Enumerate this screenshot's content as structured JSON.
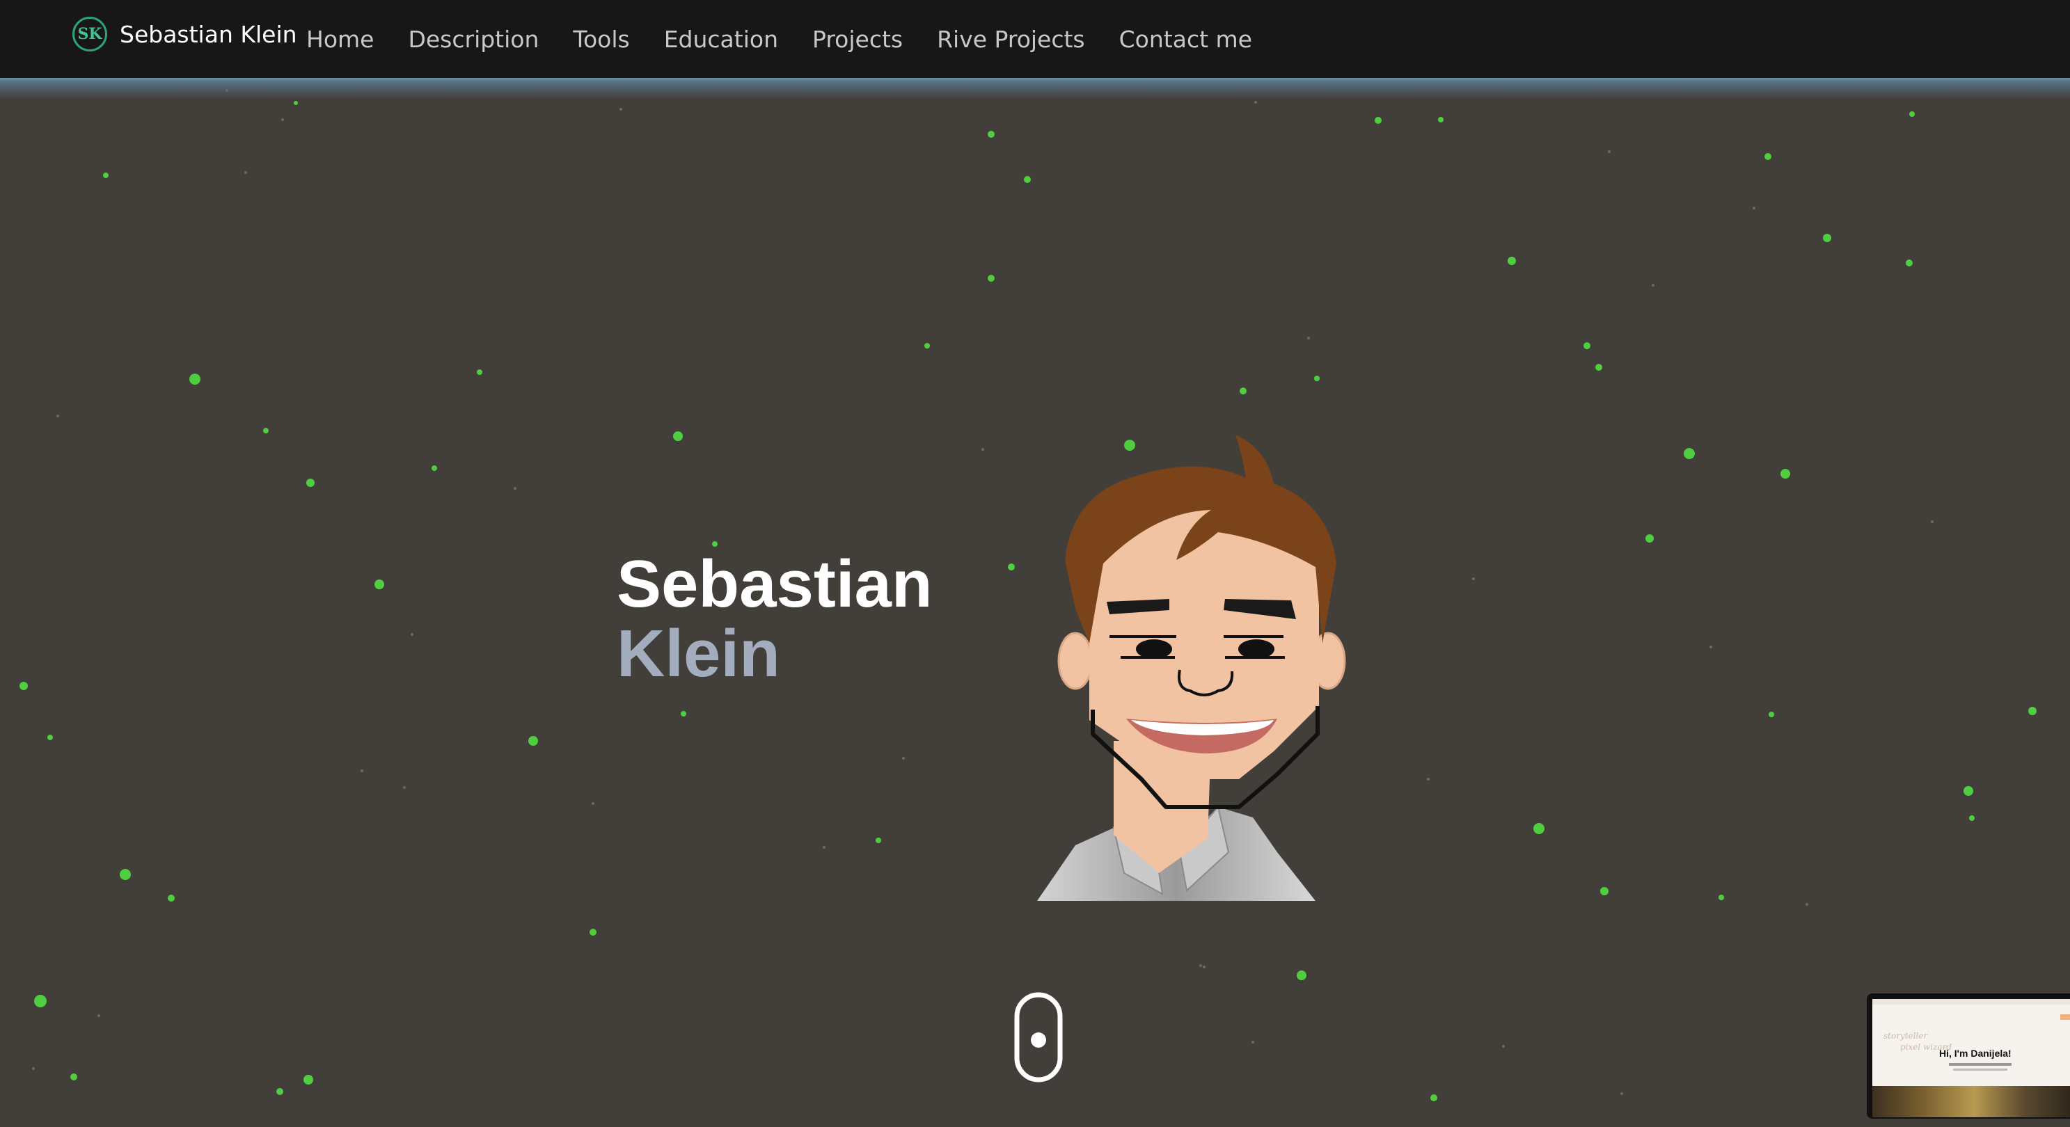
{
  "brand": {
    "logo_text": "SK",
    "name": "Sebastian Klein"
  },
  "nav": {
    "items": [
      "Home",
      "Description",
      "Tools",
      "Education",
      "Projects",
      "Rive Projects",
      "Contact me"
    ]
  },
  "hero": {
    "first_name": "Sebastian",
    "last_name": "Klein"
  },
  "preview": {
    "heading": "Hi, I'm Danijela!",
    "ghost_1": "storyteller",
    "ghost_2": "pixel wizard"
  },
  "colors": {
    "background": "#423f3b",
    "navbar": "#171717",
    "particle": "#4fcf3f",
    "hero_first": "#ffffff",
    "hero_last": "#a3adbd",
    "logo_accent": "#2ea37a"
  },
  "icons": {
    "logo": "sk-monogram-icon",
    "scroll": "mouse-scroll-icon"
  }
}
